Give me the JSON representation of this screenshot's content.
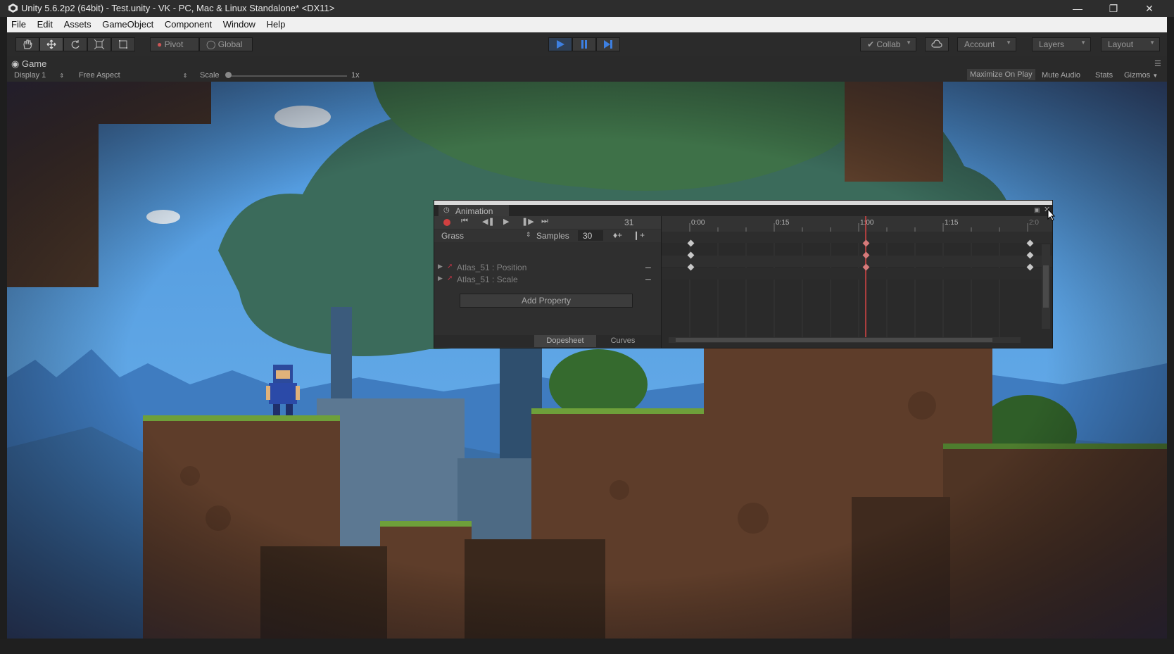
{
  "window": {
    "title": "Unity 5.6.2p2 (64bit) - Test.unity - VK - PC, Mac & Linux Standalone* <DX11>",
    "controls": [
      "minimize-icon",
      "restore-icon",
      "close-icon"
    ]
  },
  "menu": {
    "items": [
      "File",
      "Edit",
      "Assets",
      "GameObject",
      "Component",
      "Window",
      "Help"
    ]
  },
  "toolbar": {
    "tools": [
      "hand-icon",
      "move-icon",
      "rotate-icon",
      "scale-icon",
      "rect-icon"
    ],
    "pivot_label": "Pivot",
    "global_label": "Global",
    "play_icons": [
      "play-icon",
      "pause-icon",
      "step-icon"
    ],
    "collab_label": "Collab",
    "account_label": "Account",
    "layers_label": "Layers",
    "layout_label": "Layout",
    "accent_color": "#3d7fe0"
  },
  "game_view": {
    "tab_label": "Game",
    "display_label": "Display 1",
    "aspect_label": "Free Aspect",
    "scale_label": "Scale",
    "scale_value": "1x",
    "maximize_label": "Maximize On Play",
    "mute_label": "Mute Audio",
    "stats_label": "Stats",
    "gizmos_label": "Gizmos"
  },
  "animation": {
    "tab_label": "Animation",
    "frame": "31",
    "clip_name": "Grass",
    "samples_label": "Samples",
    "samples_value": "30",
    "properties": [
      {
        "label": "Atlas_51 : Position"
      },
      {
        "label": "Atlas_51 : Scale"
      }
    ],
    "add_property_label": "Add Property",
    "dopesheet_label": "Dopesheet",
    "curves_label": "Curves",
    "timeline_labels": [
      "0:00",
      "0:15",
      "1:00",
      "1:15",
      "2:0"
    ],
    "playhead_color": "#d64545"
  }
}
